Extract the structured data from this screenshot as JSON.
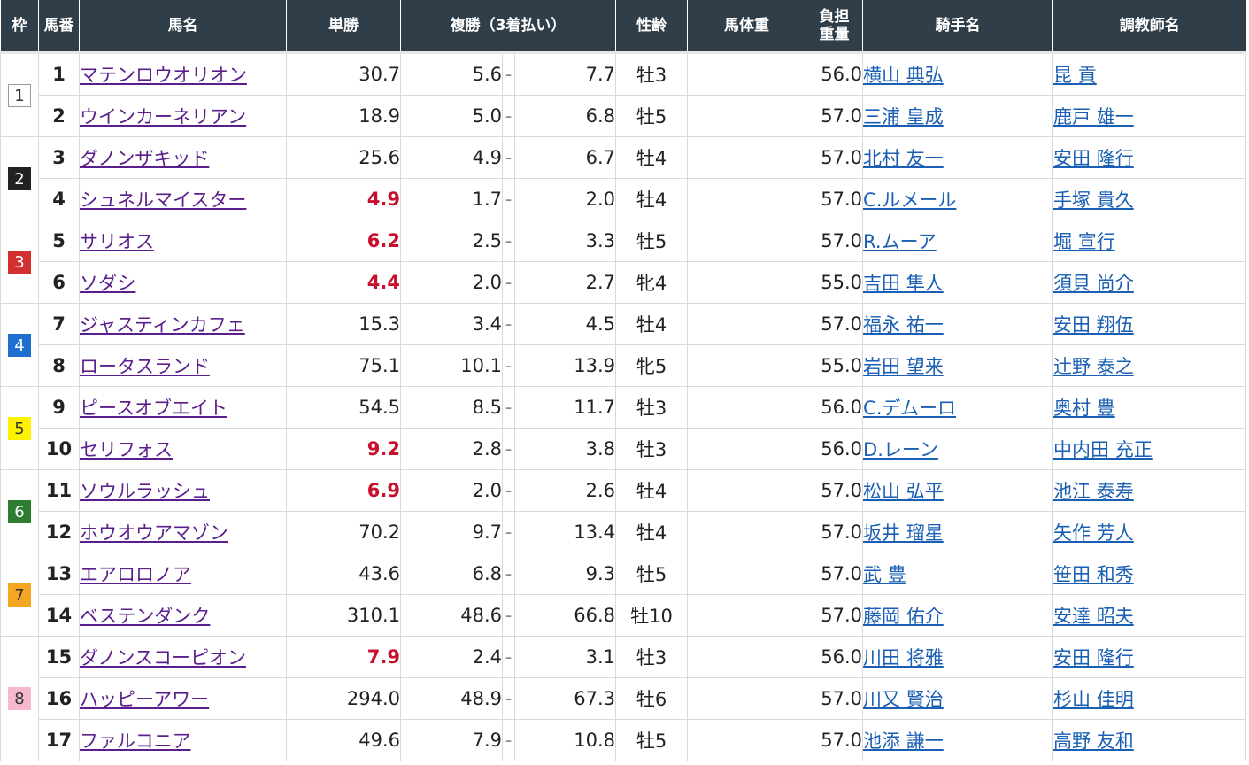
{
  "header": {
    "waku": "枠",
    "umaban": "馬番",
    "horse": "馬名",
    "win": "単勝",
    "place": "複勝（3着払い）",
    "sexage": "性齢",
    "weight": "馬体重",
    "kinryo_1": "負担",
    "kinryo_2": "重量",
    "jockey": "騎手名",
    "trainer": "調教師名"
  },
  "waku_groups": [
    {
      "waku": "1",
      "bg": "#ffffff",
      "fg": "#333333",
      "border": "#999999",
      "rows": 2
    },
    {
      "waku": "2",
      "bg": "#222222",
      "fg": "#ffffff",
      "border": "#222222",
      "rows": 2
    },
    {
      "waku": "3",
      "bg": "#d32f2f",
      "fg": "#ffffff",
      "border": "#d32f2f",
      "rows": 2
    },
    {
      "waku": "4",
      "bg": "#1e6fcf",
      "fg": "#ffffff",
      "border": "#1e6fcf",
      "rows": 2
    },
    {
      "waku": "5",
      "bg": "#fff200",
      "fg": "#333333",
      "border": "#fff200",
      "rows": 2
    },
    {
      "waku": "6",
      "bg": "#2e7d32",
      "fg": "#ffffff",
      "border": "#2e7d32",
      "rows": 2
    },
    {
      "waku": "7",
      "bg": "#f5a623",
      "fg": "#333333",
      "border": "#f5a623",
      "rows": 2
    },
    {
      "waku": "8",
      "bg": "#f6b9cc",
      "fg": "#333333",
      "border": "#f6b9cc",
      "rows": 3
    }
  ],
  "rows": [
    {
      "num": "1",
      "horse": "マテンロウオリオン",
      "win": "30.7",
      "popular": false,
      "pmin": "5.6",
      "dash": "-",
      "pmax": "7.7",
      "sex": "牡3",
      "weight": "",
      "kinryo": "56.0",
      "jockey": "横山 典弘",
      "trainer": "昆 貢"
    },
    {
      "num": "2",
      "horse": "ウインカーネリアン",
      "win": "18.9",
      "popular": false,
      "pmin": "5.0",
      "dash": "-",
      "pmax": "6.8",
      "sex": "牡5",
      "weight": "",
      "kinryo": "57.0",
      "jockey": "三浦 皇成",
      "trainer": "鹿戸 雄一"
    },
    {
      "num": "3",
      "horse": "ダノンザキッド",
      "win": "25.6",
      "popular": false,
      "pmin": "4.9",
      "dash": "-",
      "pmax": "6.7",
      "sex": "牡4",
      "weight": "",
      "kinryo": "57.0",
      "jockey": "北村 友一",
      "trainer": "安田 隆行"
    },
    {
      "num": "4",
      "horse": "シュネルマイスター",
      "win": "4.9",
      "popular": true,
      "pmin": "1.7",
      "dash": "-",
      "pmax": "2.0",
      "sex": "牡4",
      "weight": "",
      "kinryo": "57.0",
      "jockey": "C.ルメール",
      "trainer": "手塚 貴久"
    },
    {
      "num": "5",
      "horse": "サリオス",
      "win": "6.2",
      "popular": true,
      "pmin": "2.5",
      "dash": "-",
      "pmax": "3.3",
      "sex": "牡5",
      "weight": "",
      "kinryo": "57.0",
      "jockey": "R.ムーア",
      "trainer": "堀 宣行"
    },
    {
      "num": "6",
      "horse": "ソダシ",
      "win": "4.4",
      "popular": true,
      "pmin": "2.0",
      "dash": "-",
      "pmax": "2.7",
      "sex": "牝4",
      "weight": "",
      "kinryo": "55.0",
      "jockey": "吉田 隼人",
      "trainer": "須貝 尚介"
    },
    {
      "num": "7",
      "horse": "ジャスティンカフェ",
      "win": "15.3",
      "popular": false,
      "pmin": "3.4",
      "dash": "-",
      "pmax": "4.5",
      "sex": "牡4",
      "weight": "",
      "kinryo": "57.0",
      "jockey": "福永 祐一",
      "trainer": "安田 翔伍"
    },
    {
      "num": "8",
      "horse": "ロータスランド",
      "win": "75.1",
      "popular": false,
      "pmin": "10.1",
      "dash": "-",
      "pmax": "13.9",
      "sex": "牝5",
      "weight": "",
      "kinryo": "55.0",
      "jockey": "岩田 望来",
      "trainer": "辻野 泰之"
    },
    {
      "num": "9",
      "horse": "ピースオブエイト",
      "win": "54.5",
      "popular": false,
      "pmin": "8.5",
      "dash": "-",
      "pmax": "11.7",
      "sex": "牡3",
      "weight": "",
      "kinryo": "56.0",
      "jockey": "C.デムーロ",
      "trainer": "奥村 豊"
    },
    {
      "num": "10",
      "horse": "セリフォス",
      "win": "9.2",
      "popular": true,
      "pmin": "2.8",
      "dash": "-",
      "pmax": "3.8",
      "sex": "牡3",
      "weight": "",
      "kinryo": "56.0",
      "jockey": "D.レーン",
      "trainer": "中内田 充正"
    },
    {
      "num": "11",
      "horse": "ソウルラッシュ",
      "win": "6.9",
      "popular": true,
      "pmin": "2.0",
      "dash": "-",
      "pmax": "2.6",
      "sex": "牡4",
      "weight": "",
      "kinryo": "57.0",
      "jockey": "松山 弘平",
      "trainer": "池江 泰寿"
    },
    {
      "num": "12",
      "horse": "ホウオウアマゾン",
      "win": "70.2",
      "popular": false,
      "pmin": "9.7",
      "dash": "-",
      "pmax": "13.4",
      "sex": "牡4",
      "weight": "",
      "kinryo": "57.0",
      "jockey": "坂井 瑠星",
      "trainer": "矢作 芳人"
    },
    {
      "num": "13",
      "horse": "エアロロノア",
      "win": "43.6",
      "popular": false,
      "pmin": "6.8",
      "dash": "-",
      "pmax": "9.3",
      "sex": "牡5",
      "weight": "",
      "kinryo": "57.0",
      "jockey": "武 豊",
      "trainer": "笹田 和秀"
    },
    {
      "num": "14",
      "horse": "ベステンダンク",
      "win": "310.1",
      "popular": false,
      "pmin": "48.6",
      "dash": "-",
      "pmax": "66.8",
      "sex": "牡10",
      "weight": "",
      "kinryo": "57.0",
      "jockey": "藤岡 佑介",
      "trainer": "安達 昭夫"
    },
    {
      "num": "15",
      "horse": "ダノンスコーピオン",
      "win": "7.9",
      "popular": true,
      "pmin": "2.4",
      "dash": "-",
      "pmax": "3.1",
      "sex": "牡3",
      "weight": "",
      "kinryo": "56.0",
      "jockey": "川田 将雅",
      "trainer": "安田 隆行"
    },
    {
      "num": "16",
      "horse": "ハッピーアワー",
      "win": "294.0",
      "popular": false,
      "pmin": "48.9",
      "dash": "-",
      "pmax": "67.3",
      "sex": "牡6",
      "weight": "",
      "kinryo": "57.0",
      "jockey": "川又 賢治",
      "trainer": "杉山 佳明"
    },
    {
      "num": "17",
      "horse": "ファルコニア",
      "win": "49.6",
      "popular": false,
      "pmin": "7.9",
      "dash": "-",
      "pmax": "10.8",
      "sex": "牡5",
      "weight": "",
      "kinryo": "57.0",
      "jockey": "池添 謙一",
      "trainer": "高野 友和"
    }
  ]
}
